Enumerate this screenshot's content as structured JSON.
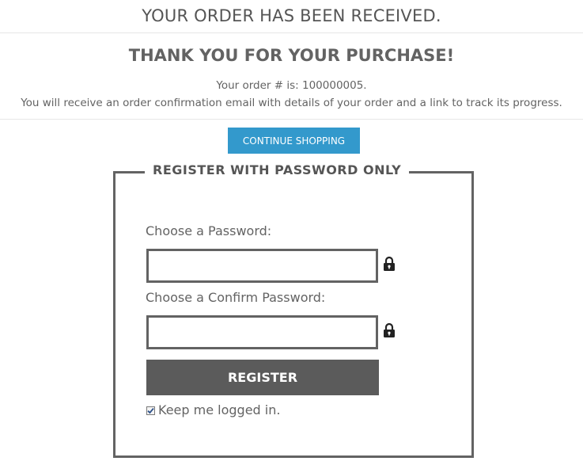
{
  "header": {
    "title": "YOUR ORDER HAS BEEN RECEIVED."
  },
  "confirmation": {
    "subtitle": "THANK YOU FOR YOUR PURCHASE!",
    "order_line": "Your order # is: 100000005.",
    "email_line": "You will receive an order confirmation email with details of your order and a link to track its progress."
  },
  "actions": {
    "continue_label": "CONTINUE SHOPPING"
  },
  "register": {
    "legend": "REGISTER WITH PASSWORD ONLY",
    "password_label": "Choose a Password:",
    "password_value": "",
    "confirm_label": "Choose a Confirm Password:",
    "confirm_value": "",
    "submit_label": "REGISTER",
    "keep_logged_in_label": "Keep me logged in.",
    "keep_logged_in_checked": true,
    "lock_icon": "lock-icon"
  },
  "colors": {
    "accent": "#3399cc",
    "register_button": "#5b5b5b",
    "border": "#636363",
    "text": "#636363"
  }
}
